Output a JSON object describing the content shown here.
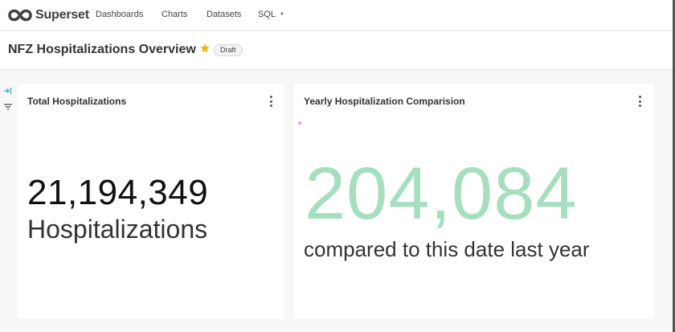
{
  "nav": {
    "brand": "Superset",
    "items": [
      {
        "label": "Dashboards"
      },
      {
        "label": "Charts"
      },
      {
        "label": "Datasets"
      },
      {
        "label": "SQL"
      }
    ]
  },
  "dashboard": {
    "title": "NFZ Hospitalizations Overview",
    "status": "Draft",
    "favorite": true,
    "star_color": "#f2b705"
  },
  "charts": [
    {
      "title": "Total Hospitalizations",
      "value": "21,194,349",
      "subheader": "Hospitalizations"
    },
    {
      "title": "Yearly Hospitalization Comparision",
      "value": "204,084",
      "subheader": "compared to this date last year",
      "value_color": "#a6dfbf"
    }
  ],
  "colors": {
    "accent": "#20a7c9",
    "positive": "#a6dfbf"
  }
}
